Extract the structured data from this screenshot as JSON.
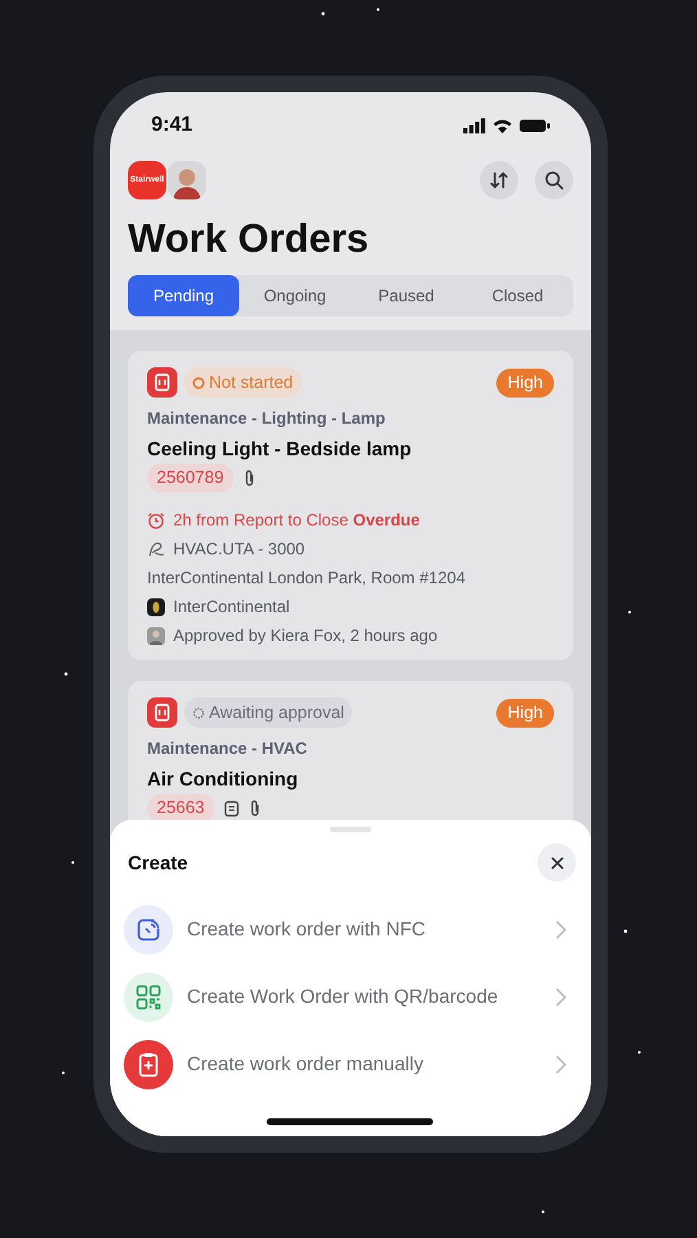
{
  "status_bar": {
    "time": "9:41"
  },
  "header": {
    "logo_text": "Stairwell",
    "title": "Work Orders"
  },
  "tabs": [
    {
      "label": "Pending",
      "selected": true
    },
    {
      "label": "Ongoing",
      "selected": false
    },
    {
      "label": "Paused",
      "selected": false
    },
    {
      "label": "Closed",
      "selected": false
    }
  ],
  "work_orders": [
    {
      "status": {
        "kind": "not_started",
        "label": "Not started"
      },
      "priority": "High",
      "category": "Maintenance - Lighting - Lamp",
      "title": "Ceeling Light - Bedside lamp",
      "id": "2560789",
      "extras": [
        {
          "kind": "attachment"
        }
      ],
      "details": [
        {
          "kind": "sla",
          "text": "2h from Report to Close **Overdue**"
        },
        {
          "kind": "asset",
          "text": "HVAC.UTA - 3000"
        },
        {
          "kind": "location",
          "text": "InterContinental London Park, Room #1204"
        },
        {
          "kind": "company",
          "text": "InterContinental"
        },
        {
          "kind": "approval",
          "text": "Approved by Kiera Fox, 2 hours ago"
        }
      ]
    },
    {
      "status": {
        "kind": "awaiting",
        "label": "Awaiting approval"
      },
      "priority": "High",
      "category": "Maintenance - HVAC",
      "title": "Air Conditioning",
      "id": "25663",
      "extras": [
        {
          "kind": "note"
        },
        {
          "kind": "attachment"
        }
      ]
    }
  ],
  "sheet": {
    "title": "Create",
    "actions": [
      {
        "kind": "nfc",
        "label": "Create work order with NFC"
      },
      {
        "kind": "qr",
        "label": "Create Work Order with QR/barcode"
      },
      {
        "kind": "manual",
        "label": "Create work order manually"
      }
    ]
  }
}
